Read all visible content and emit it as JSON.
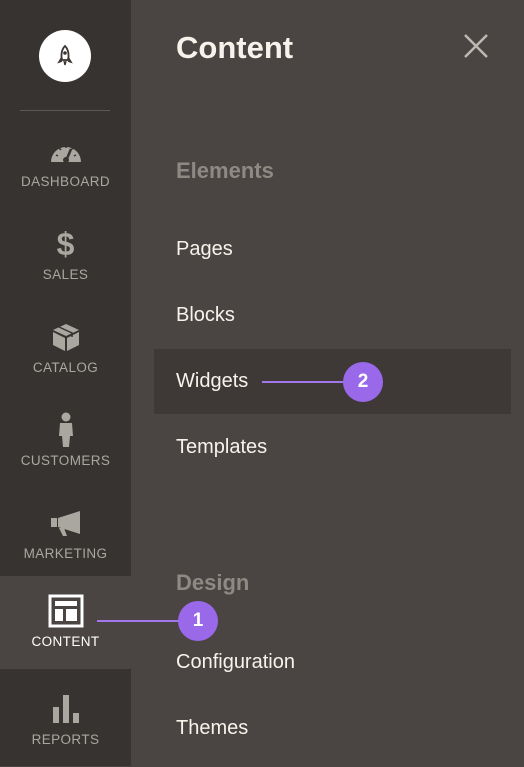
{
  "sidebar": {
    "logo_icon": "rocket-logo-icon",
    "items": [
      {
        "label": "DASHBOARD",
        "icon": "gauge-icon"
      },
      {
        "label": "SALES",
        "icon": "dollar-icon"
      },
      {
        "label": "CATALOG",
        "icon": "box-icon"
      },
      {
        "label": "CUSTOMERS",
        "icon": "person-icon"
      },
      {
        "label": "MARKETING",
        "icon": "megaphone-icon"
      },
      {
        "label": "CONTENT",
        "icon": "layout-icon",
        "active": true
      },
      {
        "label": "REPORTS",
        "icon": "bar-chart-icon"
      }
    ]
  },
  "panel": {
    "title": "Content",
    "close_icon": "close-icon",
    "sections": [
      {
        "title": "Elements",
        "items": [
          "Pages",
          "Blocks",
          "Widgets",
          "Templates"
        ]
      },
      {
        "title": "Design",
        "items": [
          "Configuration",
          "Themes"
        ]
      }
    ],
    "highlighted_item": "Widgets"
  },
  "callouts": [
    "1",
    "2"
  ],
  "colors": {
    "sidebar_bg": "#373330",
    "panel_bg": "#4a4542",
    "highlight_bg": "#3e3936",
    "callout": "#9a69ea",
    "text_light": "#f7f3eb",
    "section_title": "#8e8983"
  }
}
